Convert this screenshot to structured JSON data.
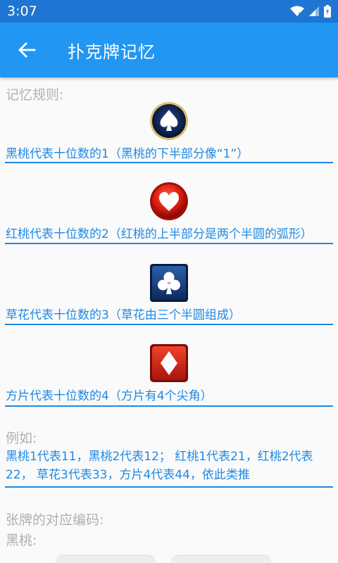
{
  "status": {
    "time": "3:07"
  },
  "app_bar": {
    "title": "扑克牌记忆",
    "back_icon": "arrow-back-icon"
  },
  "rules_label": "记忆规则:",
  "rules": [
    {
      "suit_icon": "spade-icon",
      "text": "黑桃代表十位数的1（黑桃的下半部分像“1”）"
    },
    {
      "suit_icon": "heart-icon",
      "text": "红桃代表十位数的2（红桃的上半部分是两个半圆的弧形）"
    },
    {
      "suit_icon": "club-icon",
      "text": "草花代表十位数的3（草花由三个半圆组成）"
    },
    {
      "suit_icon": "diamond-icon",
      "text": "方片代表十位数的4（方片有4个尖角）"
    }
  ],
  "example": {
    "label": "例如:",
    "line1": "黑桃1代表11，黑桃2代表12； 红桃1代表21，红桃2代表",
    "line2": "22， 草花3代表33，方片4代表44，依此类推"
  },
  "codes": {
    "label": "张牌的对应编码:",
    "spade_label": "黑桃:"
  },
  "colors": {
    "app_bar": "#2196f3",
    "status_bar": "#1e76d2",
    "accent_text": "#1e88e5",
    "muted_label": "#b0b0b0"
  }
}
